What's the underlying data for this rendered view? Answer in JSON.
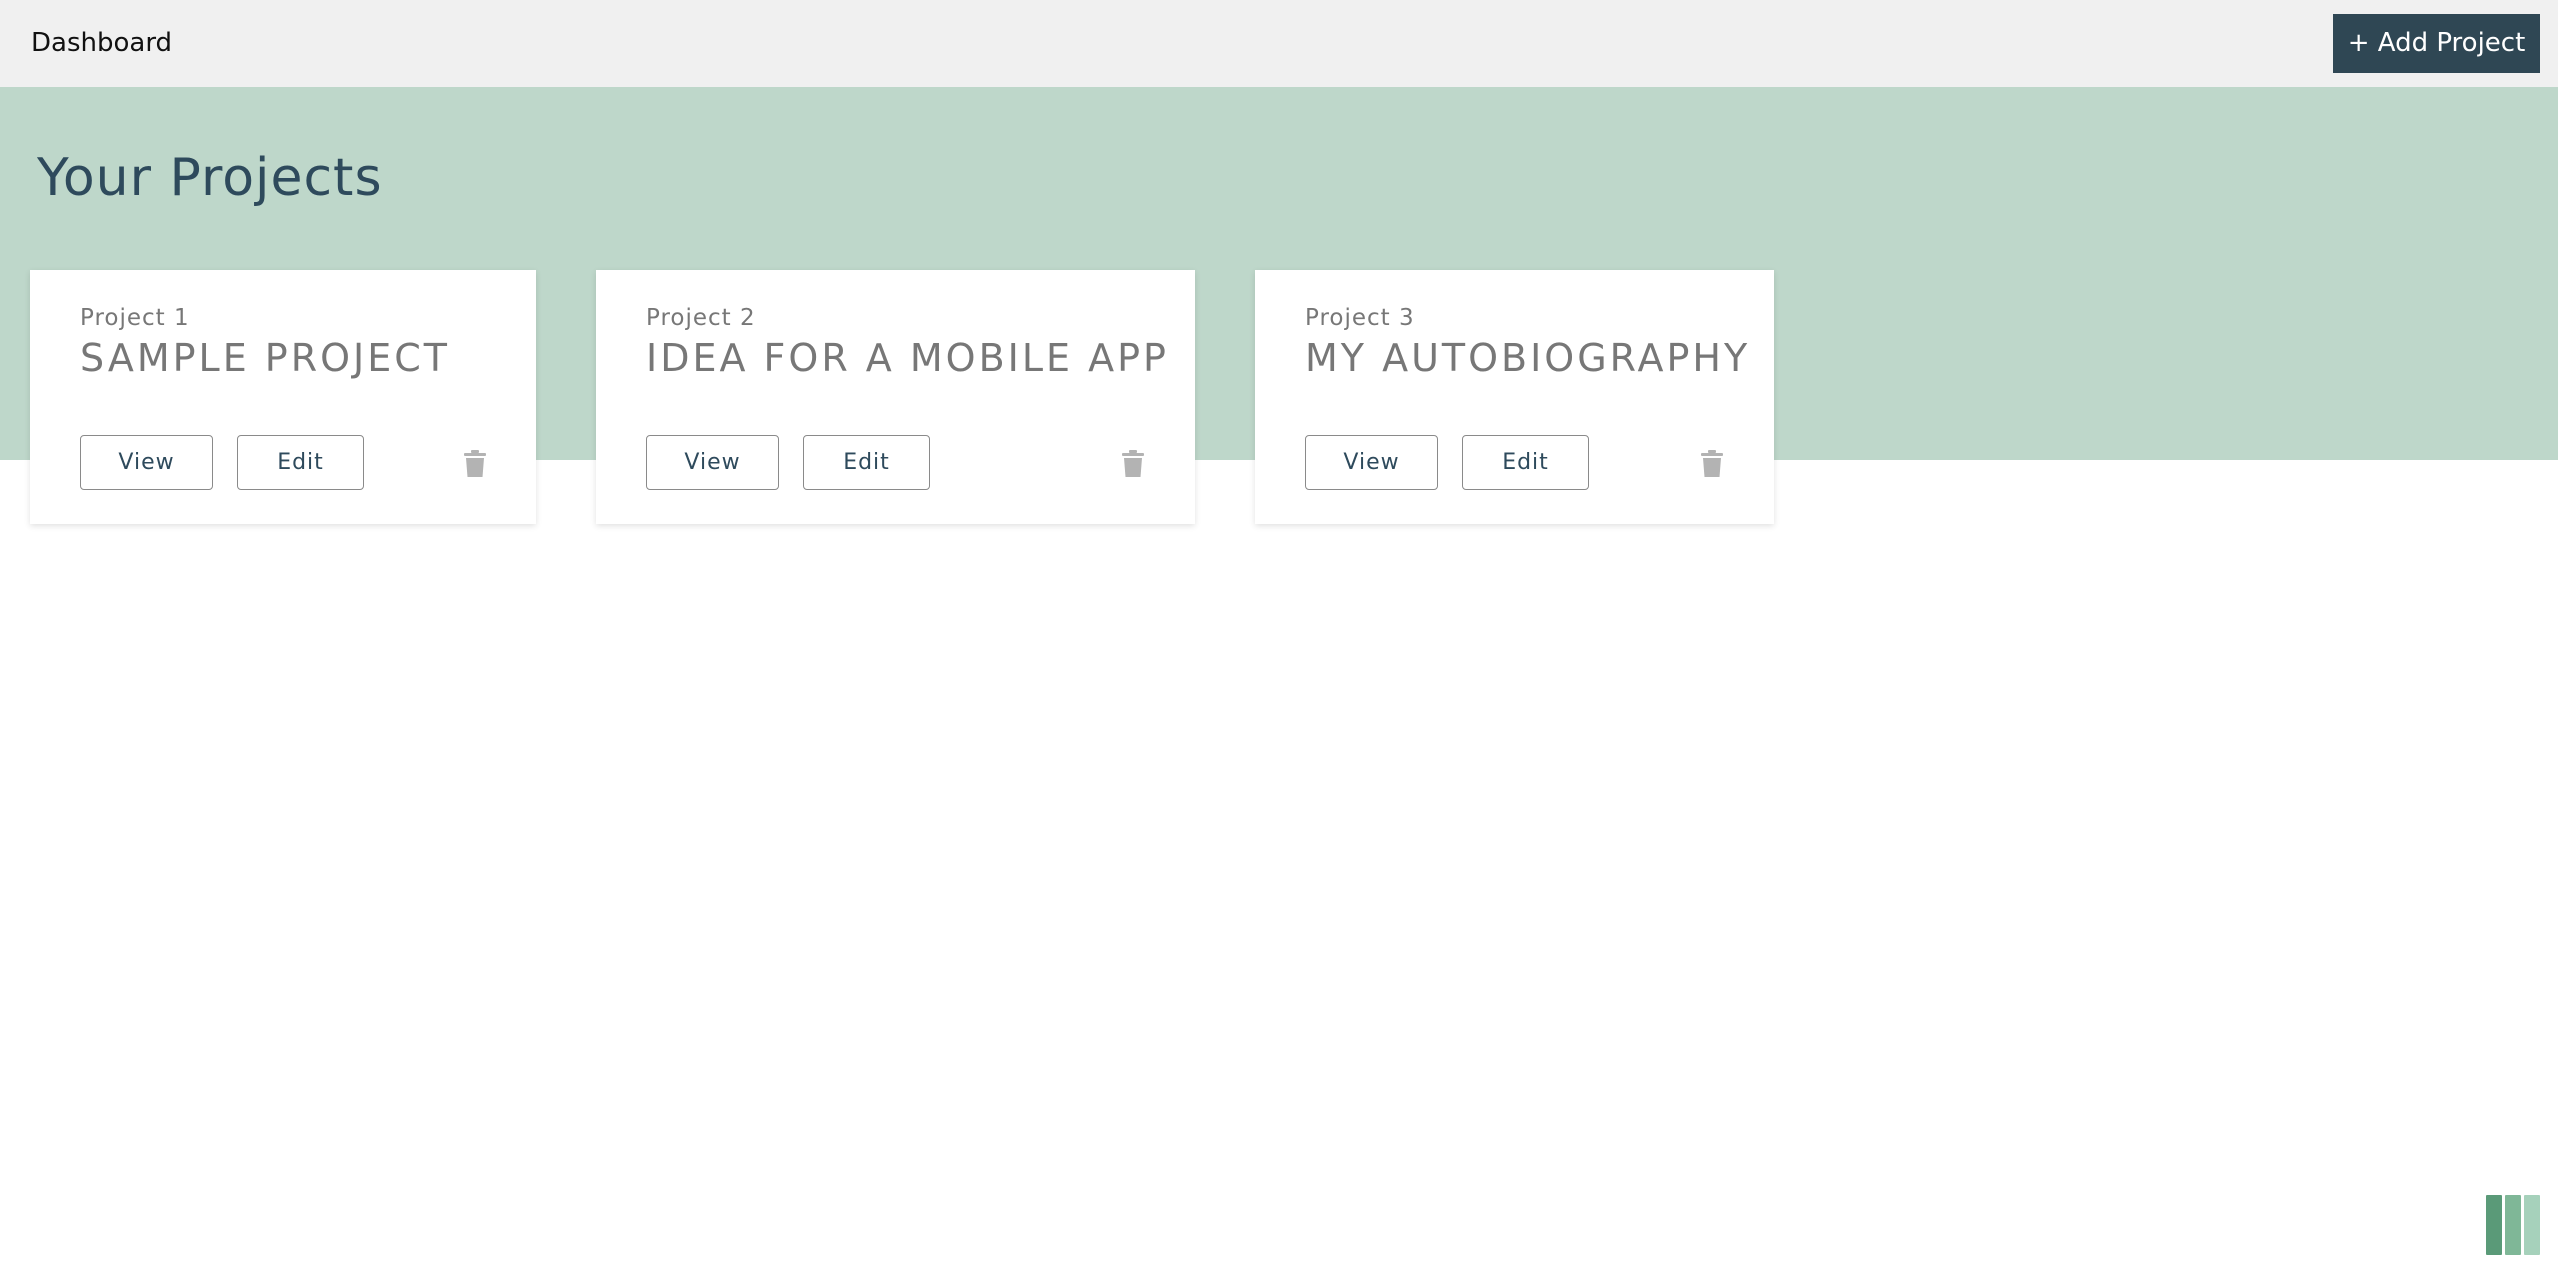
{
  "header": {
    "title": "Dashboard",
    "add_project_label": "+ Add Project"
  },
  "main": {
    "heading": "Your Projects",
    "projects": [
      {
        "number_label": "Project 1",
        "title": "SAMPLE PROJECT",
        "view_label": "View",
        "edit_label": "Edit"
      },
      {
        "number_label": "Project 2",
        "title": "IDEA FOR A MOBILE APP",
        "view_label": "View",
        "edit_label": "Edit"
      },
      {
        "number_label": "Project 3",
        "title": "MY AUTOBIOGRAPHY",
        "view_label": "View",
        "edit_label": "Edit"
      }
    ]
  },
  "icons": {
    "delete": "trash-icon",
    "corner": "bars-logo-icon"
  },
  "colors": {
    "header_bg": "#f0f0f0",
    "hero_bg": "#bed7ca",
    "primary_button": "#2f4754",
    "heading_text": "#2e4a5c",
    "card_text": "#777777",
    "icon_gray": "#b3b3b3",
    "logo_greens": [
      "#5a9a78",
      "#7fb797",
      "#a6d1bb"
    ]
  }
}
